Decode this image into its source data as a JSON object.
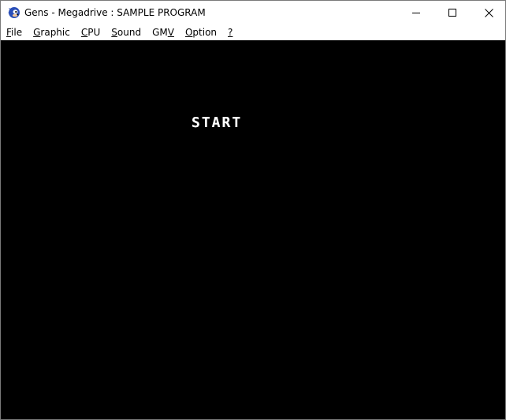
{
  "window": {
    "title": "Gens - Megadrive : SAMPLE PROGRAM",
    "app_icon": "sonic-icon",
    "controls": {
      "minimize": "minimize-icon",
      "maximize": "maximize-icon",
      "close": "close-icon"
    }
  },
  "menubar": {
    "items": [
      {
        "pre": "",
        "key": "F",
        "post": "ile"
      },
      {
        "pre": "",
        "key": "G",
        "post": "raphic"
      },
      {
        "pre": "",
        "key": "C",
        "post": "PU"
      },
      {
        "pre": "",
        "key": "S",
        "post": "ound"
      },
      {
        "pre": "GM",
        "key": "V",
        "post": ""
      },
      {
        "pre": "",
        "key": "O",
        "post": "ption"
      },
      {
        "pre": "",
        "key": "?",
        "post": ""
      }
    ]
  },
  "screen": {
    "text": "START",
    "background": "#000000",
    "text_color": "#ffffff"
  }
}
